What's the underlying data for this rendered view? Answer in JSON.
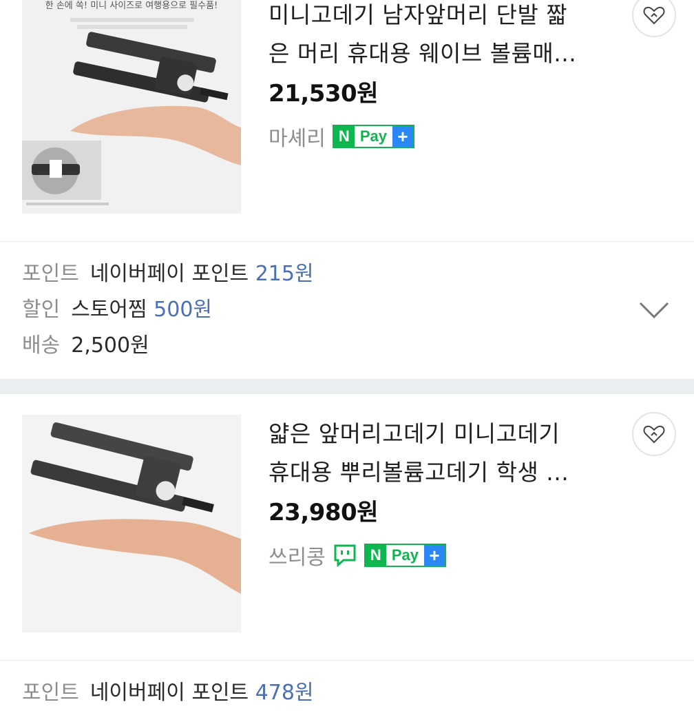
{
  "products": [
    {
      "title": "미니고데기 남자앞머리 단발 짧\n은 머리 휴대용 웨이브 볼륨매...",
      "price": "21,530",
      "currency": "원",
      "seller": "마셰리",
      "image_caption": "한 손에 쏙! 미니 사이즈로 여행용으로 필수품!",
      "talk_icon": false
    },
    {
      "title": "얇은 앞머리고데기 미니고데기\n휴대용 뿌리볼륨고데기 학생 ...",
      "price": "23,980",
      "currency": "원",
      "seller": "쓰리콩",
      "talk_icon": true
    }
  ],
  "npay": {
    "n": "N",
    "pay": "Pay",
    "plus": "+"
  },
  "info": {
    "point_label": "포인트",
    "point_text": "네이버페이 포인트",
    "point_value": "215원",
    "discount_label": "할인",
    "discount_text": "스토어찜",
    "discount_value": "500원",
    "shipping_label": "배송",
    "shipping_value": "2,500원"
  },
  "next_info": {
    "point_label": "포인트",
    "point_text": "네이버페이 포인트",
    "point_value": "478원"
  },
  "colors": {
    "npay_green": "#0fb650",
    "npay_blue": "#2b87f5",
    "value_blue": "#4a6fb7",
    "gray_label": "#8d8d8d"
  }
}
